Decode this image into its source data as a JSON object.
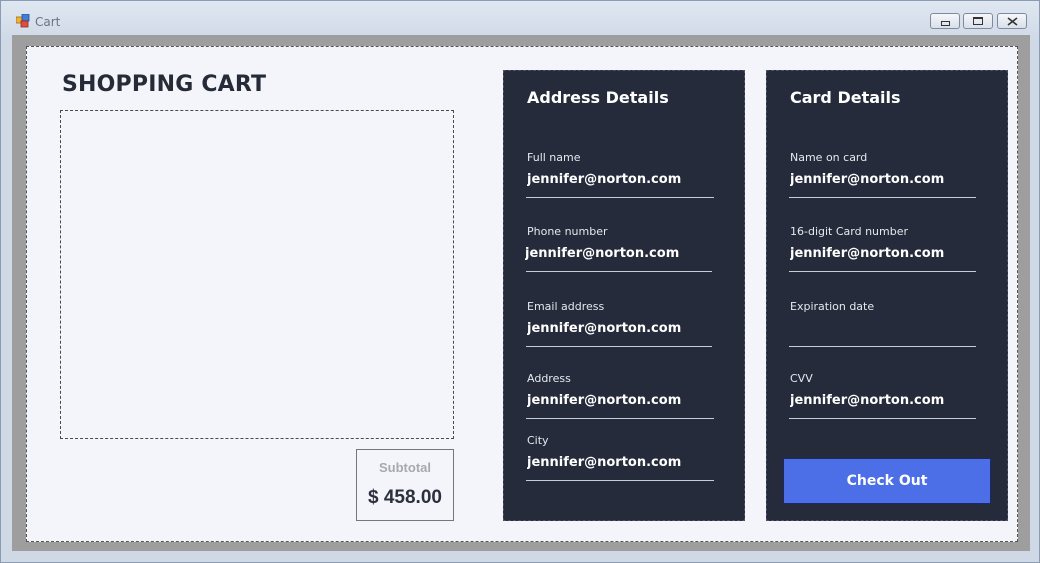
{
  "window": {
    "title": "Cart",
    "app_icon": "windows-form-icon",
    "buttons": [
      {
        "name": "minimize",
        "glyph": "▭"
      },
      {
        "name": "maximize",
        "glyph": "▣"
      },
      {
        "name": "close",
        "glyph": "✕"
      }
    ]
  },
  "cart": {
    "heading": "SHOPPING CART",
    "subtotal_label": "Subtotal",
    "subtotal_value": "$ 458.00"
  },
  "address": {
    "title": "Address Details",
    "fields": [
      {
        "label": "Full name",
        "value": "jennifer@norton.com"
      },
      {
        "label": "Phone number",
        "value": "jennifer@norton.com"
      },
      {
        "label": "Email address",
        "value": "jennifer@norton.com"
      },
      {
        "label": "Address",
        "value": "jennifer@norton.com"
      },
      {
        "label": "City",
        "value": "jennifer@norton.com"
      }
    ]
  },
  "card": {
    "title": "Card Details",
    "fields": [
      {
        "label": "Name on card",
        "value": "jennifer@norton.com"
      },
      {
        "label": "16-digit Card number",
        "value": "jennifer@norton.com"
      },
      {
        "label": "Expiration date",
        "value": ""
      },
      {
        "label": "CVV",
        "value": "jennifer@norton.com"
      }
    ],
    "checkout_label": "Check Out"
  },
  "colors": {
    "panel_bg": "#252b3b",
    "accent": "#4c6ee6",
    "client_bg": "#f3f5fa"
  }
}
